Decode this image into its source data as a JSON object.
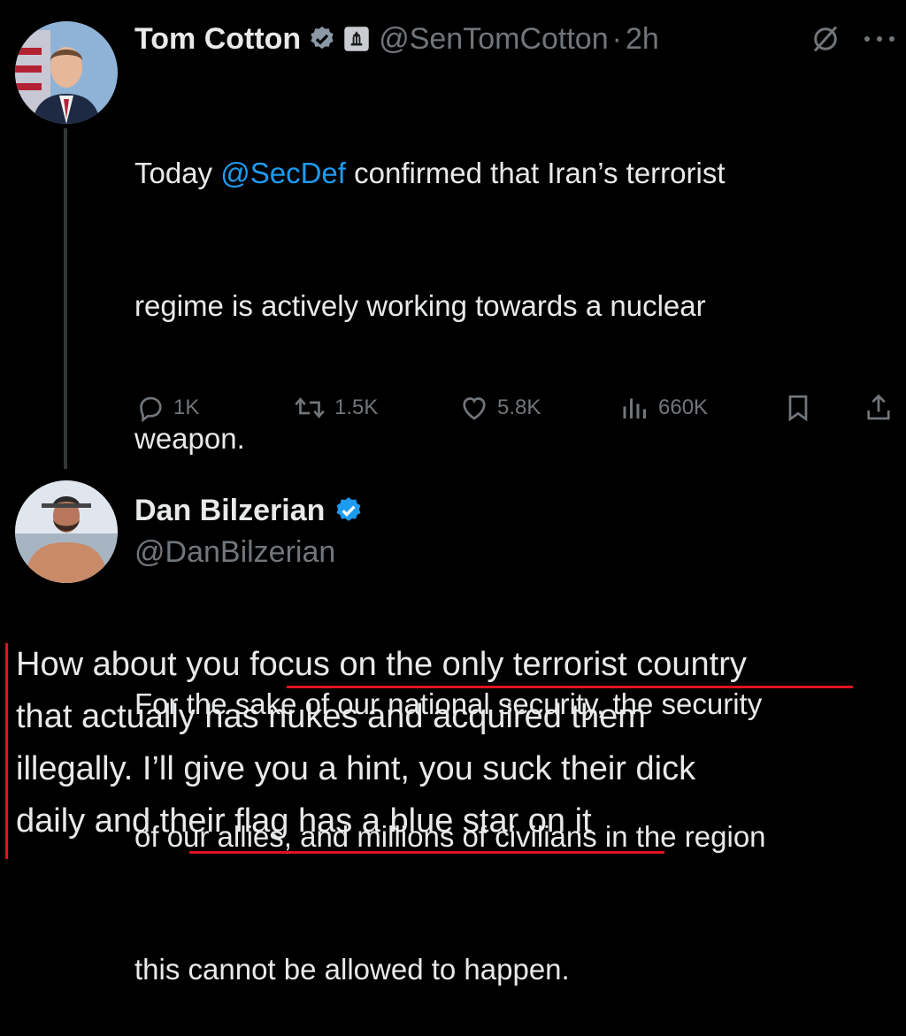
{
  "tweet": {
    "author_name": "Tom Cotton",
    "author_handle": "@SenTomCotton",
    "separator": "·",
    "time": "2h",
    "text_prefix": "Today ",
    "mention": "@SecDef",
    "text_line1_rest": " confirmed that Iran’s terrorist",
    "text_line2": "regime is actively working towards a nuclear",
    "text_line3": "weapon.",
    "text_line4": "For the sake of our national security, the security",
    "text_line5": "of our allies, and millions of civilians in the region",
    "text_line6": "this cannot be allowed to happen.",
    "stats": {
      "replies": "1K",
      "reposts": "1.5K",
      "likes": "5.8K",
      "views": "660K"
    },
    "icons": {
      "verified": "verified-badge-icon",
      "gov": "government-building-icon",
      "grok": "grok-icon",
      "more": "more-icon"
    }
  },
  "reply": {
    "author_name": "Dan Bilzerian",
    "author_handle": "@DanBilzerian",
    "line1_a": "How about you ",
    "line1_b": "focus on the only terrorist country",
    "line2": "that actually has nukes and acquired them",
    "line3": "illegally. I’ll give you a hint, you suck their dick",
    "line4_a": "daily and ",
    "line4_b": "their flag has a blue star on it"
  },
  "colors": {
    "background": "#000000",
    "text": "#e7e9ea",
    "muted": "#71767b",
    "accent": "#1d9bf0",
    "annotation": "#e0141e"
  }
}
